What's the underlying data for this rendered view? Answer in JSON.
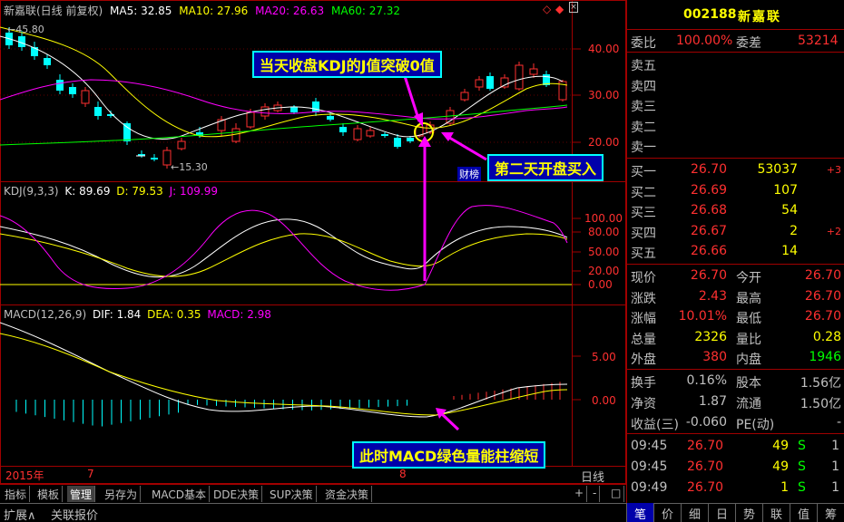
{
  "header": {
    "name": "新嘉联(日线 前复权)",
    "ma5": "MA5: 32.85",
    "ma10": "MA10: 27.96",
    "ma20": "MA20: 26.63",
    "ma60": "MA60: 27.32"
  },
  "kdj_header": {
    "name": "KDJ(9,3,3)",
    "k": "K: 89.69",
    "d": "D: 79.53",
    "j": "J: 109.99"
  },
  "macd_header": {
    "name": "MACD(12,26,9)",
    "dif": "DIF: 1.84",
    "dea": "DEA: 0.35",
    "macd": "MACD: 2.98"
  },
  "price_axis": [
    "40.00",
    "30.00",
    "20.00"
  ],
  "kdj_axis": [
    "100.00",
    "80.00",
    "50.00",
    "20.00",
    "0.00"
  ],
  "macd_axis": [
    "5.00",
    "0.00"
  ],
  "high_label": "45.80",
  "low_label": "15.30",
  "cai_badge": "财榜",
  "time_axis": {
    "year": "2015年",
    "m7": "7",
    "m8": "8",
    "period": "日线"
  },
  "annotations": {
    "kdj_note": "当天收盘KDJ的J值突破0值",
    "buy_note": "第二天开盘买入",
    "macd_note": "此时MACD绿色量能柱缩短"
  },
  "tabs": [
    "指标",
    "模板",
    "管理",
    "另存为",
    "MACD基本",
    "DDE决策",
    "SUP决策",
    "资金决策"
  ],
  "tab_controls": [
    "+",
    "-",
    "□"
  ],
  "bottom": {
    "expand": "扩展∧",
    "linked": "关联报价"
  },
  "quote": {
    "code": "002188",
    "name": "新嘉联",
    "weibi_label": "委比",
    "weibi_value": "100.00%",
    "weicha_label": "委差",
    "weicha_value": "53214",
    "sell": [
      {
        "label": "卖五"
      },
      {
        "label": "卖四"
      },
      {
        "label": "卖三"
      },
      {
        "label": "卖二"
      },
      {
        "label": "卖一"
      }
    ],
    "buy": [
      {
        "label": "买一",
        "price": "26.70",
        "vol": "53037",
        "chg": "+3"
      },
      {
        "label": "买二",
        "price": "26.69",
        "vol": "107",
        "chg": ""
      },
      {
        "label": "买三",
        "price": "26.68",
        "vol": "54",
        "chg": ""
      },
      {
        "label": "买四",
        "price": "26.67",
        "vol": "2",
        "chg": "+2"
      },
      {
        "label": "买五",
        "price": "26.66",
        "vol": "14",
        "chg": ""
      }
    ],
    "stats": [
      {
        "l1": "现价",
        "v1": "26.70",
        "l2": "今开",
        "v2": "26.70"
      },
      {
        "l1": "涨跌",
        "v1": "2.43",
        "l2": "最高",
        "v2": "26.70"
      },
      {
        "l1": "涨幅",
        "v1": "10.01%",
        "l2": "最低",
        "v2": "26.70"
      },
      {
        "l1": "总量",
        "v1": "2326",
        "l2": "量比",
        "v2": "0.28"
      },
      {
        "l1": "外盘",
        "v1": "380",
        "l2": "内盘",
        "v2": "1946"
      }
    ],
    "stats2": [
      {
        "l1": "换手",
        "v1": "0.16%",
        "l2": "股本",
        "v2": "1.56亿"
      },
      {
        "l1": "净资",
        "v1": "1.87",
        "l2": "流通",
        "v2": "1.50亿"
      },
      {
        "l1": "收益(三)",
        "v1": "-0.060",
        "l2": "PE(动)",
        "v2": "-"
      }
    ],
    "ticks": [
      {
        "time": "09:45",
        "price": "26.70",
        "vol": "49",
        "flag": "S",
        "n": "1"
      },
      {
        "time": "09:45",
        "price": "26.70",
        "vol": "49",
        "flag": "S",
        "n": "1"
      },
      {
        "time": "09:49",
        "price": "26.70",
        "vol": "1",
        "flag": "S",
        "n": "1"
      }
    ],
    "right_tabs": [
      "笔",
      "价",
      "细",
      "日",
      "势",
      "联",
      "值",
      "筹"
    ]
  },
  "colors": {
    "up": "#ff3030",
    "down": "#00ffff",
    "ma5": "#ffffff",
    "ma10": "#ffff00",
    "ma20": "#ff00ff",
    "ma60": "#00ff00",
    "frame": "#a00000"
  }
}
